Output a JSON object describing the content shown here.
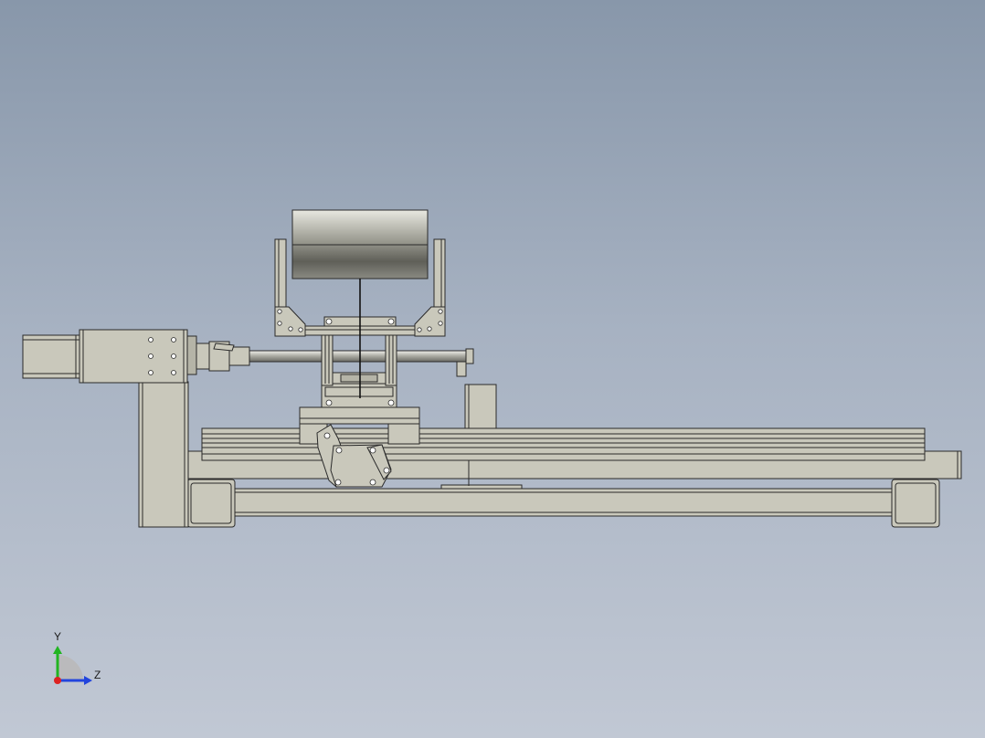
{
  "viewport": {
    "background_top": "#8897aa",
    "background_bottom": "#c1c8d4",
    "part_color": "#c9c8bb",
    "edge_color": "#2a2a2a"
  },
  "triad": {
    "y_label": "Y",
    "z_label": "Z",
    "y_color": "#22b522",
    "z_color": "#2244dd",
    "x_color": "#dd2222"
  }
}
